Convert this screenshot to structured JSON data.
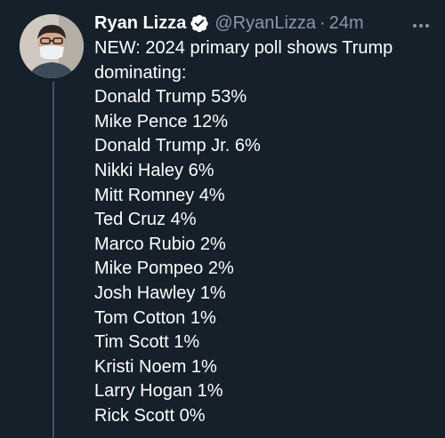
{
  "tweet": {
    "author": {
      "name": "Ryan Lizza",
      "handle": "@RyanLizza",
      "verified": true
    },
    "separator": "·",
    "time": "24m",
    "text_lines": [
      "NEW: 2024 primary poll shows Trump",
      "dominating:"
    ],
    "poll": [
      "Donald Trump 53%",
      "Mike Pence 12%",
      "Donald Trump Jr. 6%",
      "Nikki Haley 6%",
      "Mitt Romney 4%",
      "Ted Cruz 4%",
      "Marco Rubio 2%",
      "Mike Pompeo 2%",
      "Josh Hawley 1%",
      "Tom Cotton 1%",
      "Tim Scott 1%",
      "Kristi Noem 1%",
      "Larry Hogan 1%",
      "Rick Scott 0%"
    ]
  },
  "icons": {
    "verified": "verified-badge-icon",
    "more": "more-horizontal-icon"
  },
  "colors": {
    "background": "#15202b",
    "text": "#ffffff",
    "secondary_text": "#8899a6",
    "verified": "#1d9bf0",
    "thread_line": "#3d5466"
  }
}
